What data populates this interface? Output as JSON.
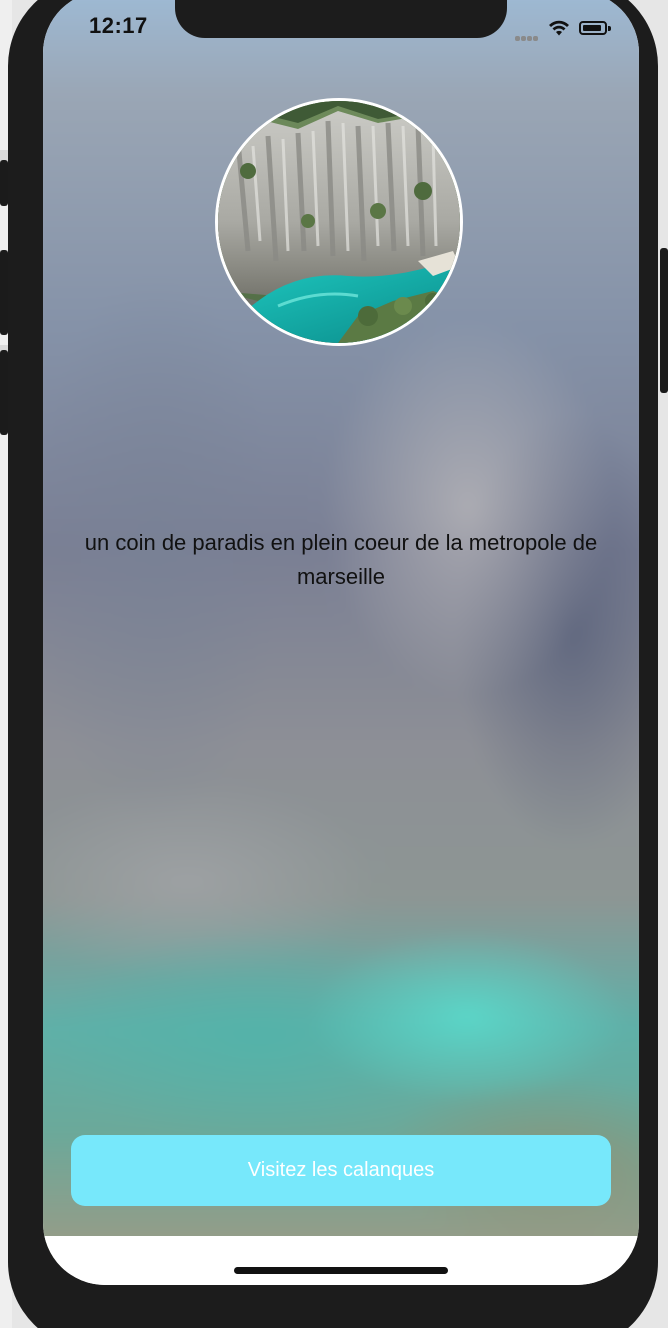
{
  "status_bar": {
    "time": "12:17",
    "icons": [
      "cellular-signal-icon",
      "wifi-icon",
      "battery-icon"
    ]
  },
  "hero_image": {
    "subject": "calanque-cliffs-photo",
    "border_color": "#ffffff"
  },
  "caption": {
    "text": "un coin de paradis en plein coeur de la metropole de marseille"
  },
  "cta_button": {
    "label": "Visitez les calanques",
    "background_color": "#77e8fb",
    "text_color": "#ffffff"
  },
  "home_indicator": {
    "color": "#111111"
  }
}
